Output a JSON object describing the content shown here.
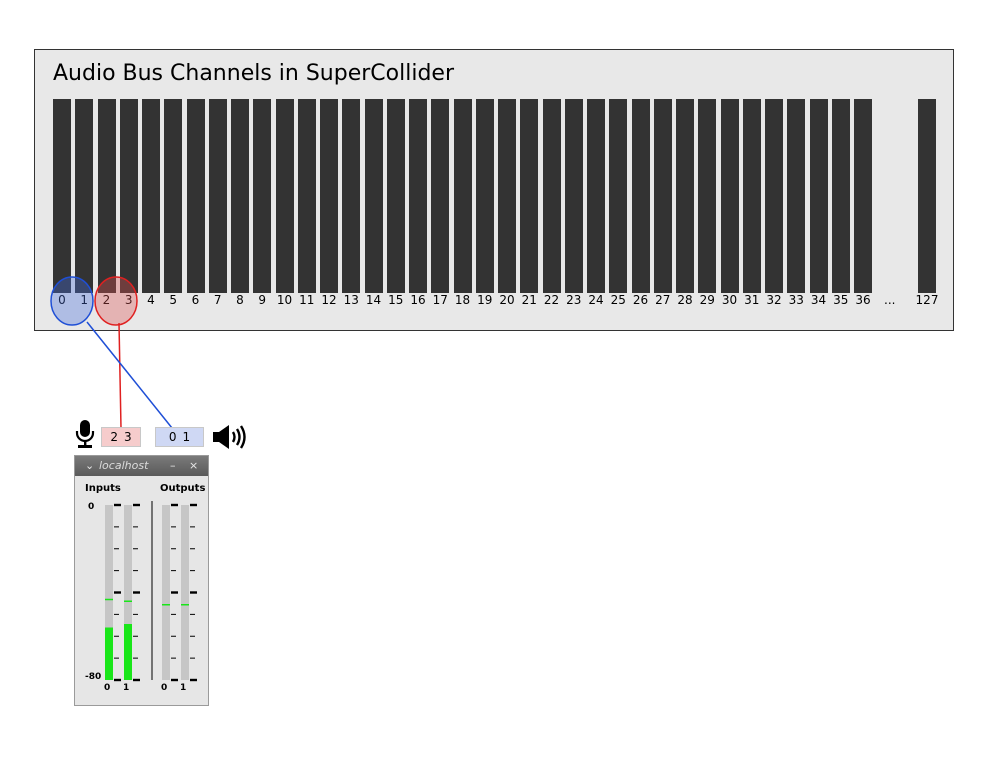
{
  "bus_panel": {
    "title": "Audio Bus Channels in SuperCollider",
    "channels": [
      "0",
      "1",
      "2",
      "3",
      "4",
      "5",
      "6",
      "7",
      "8",
      "9",
      "10",
      "11",
      "12",
      "13",
      "14",
      "15",
      "16",
      "17",
      "18",
      "19",
      "20",
      "21",
      "22",
      "23",
      "24",
      "25",
      "26",
      "27",
      "28",
      "29",
      "30",
      "31",
      "32",
      "33",
      "34",
      "35",
      "36"
    ],
    "ellipsis": "...",
    "last_channel": "127",
    "bar_color": "#333333"
  },
  "highlights": {
    "input_color": "#e02020",
    "output_color": "#1f4fd6"
  },
  "io_chips": {
    "input_icon": "microphone-icon",
    "inputs": [
      "2",
      "3"
    ],
    "outputs": [
      "0",
      "1"
    ],
    "output_icon": "speaker-icon"
  },
  "meter_window": {
    "title": "localhost",
    "minimize": "–",
    "close": "×",
    "inputs_label": "Inputs",
    "outputs_label": "Outputs",
    "scale_top": "0",
    "scale_bottom": "-80",
    "input_channels": [
      "0",
      "1"
    ],
    "output_channels": [
      "0",
      "1"
    ],
    "input_levels": [
      0.3,
      0.32
    ],
    "input_peaks": [
      0.46,
      0.45
    ],
    "output_levels": [
      0,
      0
    ],
    "output_peaks": [
      0.43,
      0.43
    ],
    "level_color": "#19e619"
  }
}
